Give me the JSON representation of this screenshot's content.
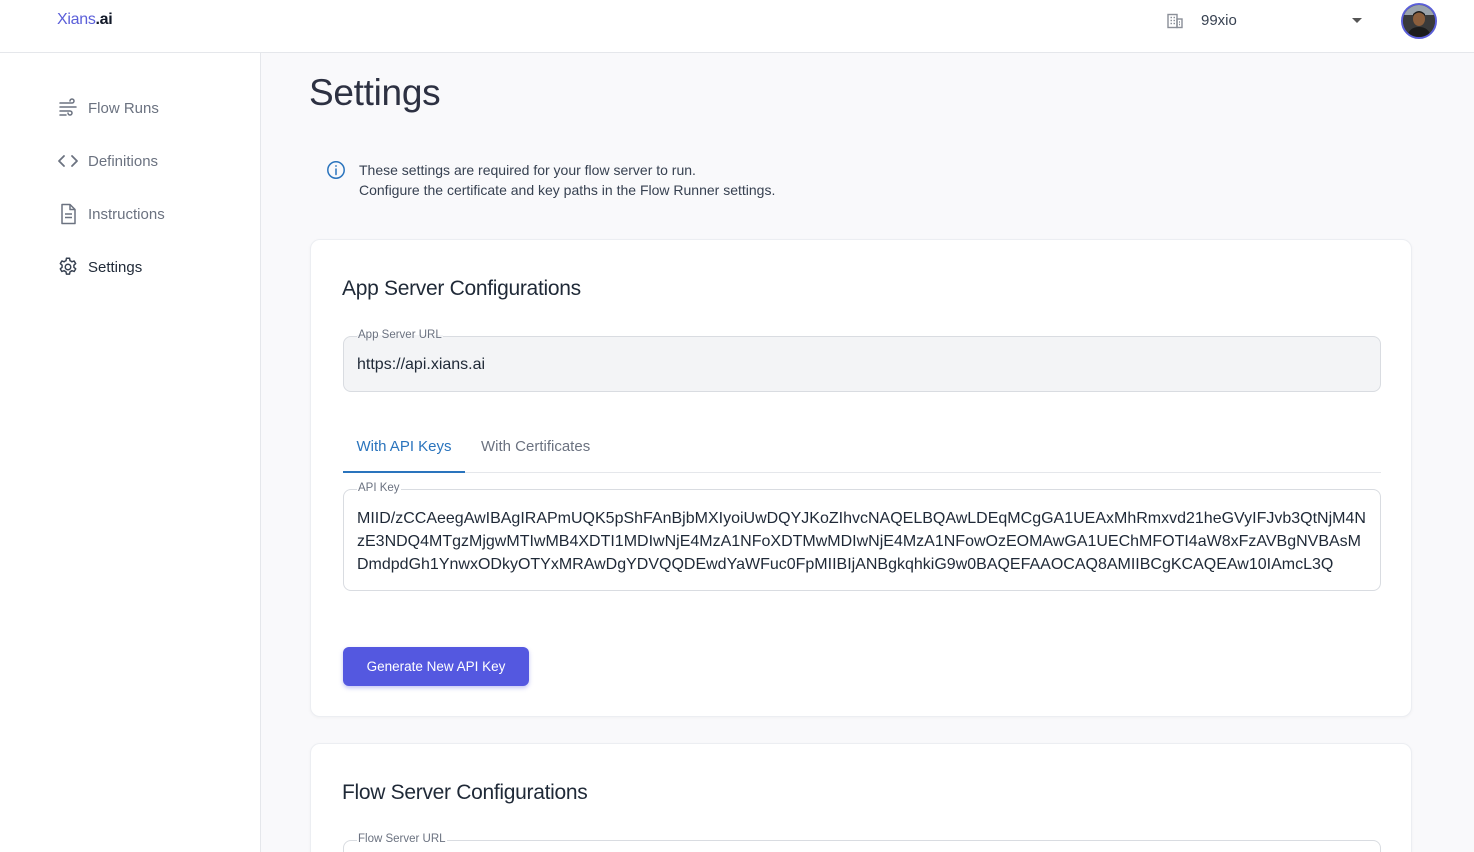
{
  "header": {
    "logo_brand": "Xians",
    "logo_tld": ".ai",
    "org_icon": "building-icon",
    "org_name": "99xio",
    "avatar_alt": "user-avatar"
  },
  "sidebar": {
    "items": [
      {
        "label": "Flow Runs",
        "icon": "flow-runs-icon"
      },
      {
        "label": "Definitions",
        "icon": "code-icon"
      },
      {
        "label": "Instructions",
        "icon": "document-icon"
      },
      {
        "label": "Settings",
        "icon": "gear-icon",
        "active": true
      }
    ]
  },
  "main": {
    "title": "Settings",
    "info_line1": "These settings are required for your flow server to run.",
    "info_line2": "Configure the certificate and key paths in the Flow Runner settings."
  },
  "app_server": {
    "title": "App Server Configurations",
    "url_label": "App Server URL",
    "url_value": "https://api.xians.ai",
    "tabs": [
      "With API Keys",
      "With Certificates"
    ],
    "active_tab": "With API Keys",
    "api_key_label": "API Key",
    "api_key_value": "MIID/zCCAeegAwIBAgIRAPmUQK5pShFAnBjbMXIyoiUwDQYJKoZIhvcNAQELBQAwLDEqMCgGA1UEAxMhRmxvd21heGVyIFJvb3QtNjM4NzE3NDQ4MTgzMjgwMTIwMB4XDTI1MDIwNjE4MzA1NFoXDTMwMDIwNjE4MzA1NFowOzEOMAwGA1UEChMFOTI4aW8xFzAVBgNVBAsMDmdpdGh1YnwxODkyOTYxMRAwDgYDVQQDEwdYaWFuc0FpMIIBIjANBgkqhkiG9w0BAQEFAAOCAQ8AMIIBCgKCAQEAw10IAmcL3Q",
    "generate_button": "Generate New API Key"
  },
  "flow_server": {
    "title": "Flow Server Configurations",
    "url_label": "Flow Server URL"
  },
  "colors": {
    "brand": "#5b5fd9",
    "tab_active": "#2a74bd",
    "button": "#5458e0",
    "info_icon": "#2a74bd"
  }
}
